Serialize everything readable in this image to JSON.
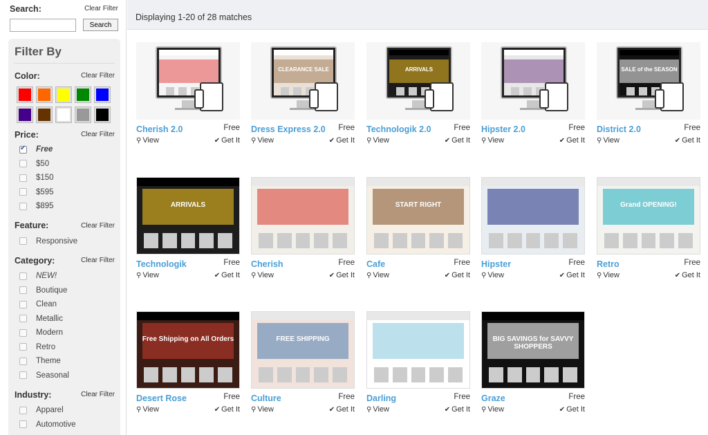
{
  "search": {
    "label": "Search:",
    "clear": "Clear Filter",
    "value": "",
    "placeholder": "",
    "button": "Search"
  },
  "filter": {
    "title": "Filter By",
    "color": {
      "label": "Color:",
      "clear": "Clear Filter",
      "swatches": [
        "#ff0000",
        "#ff6600",
        "#ffff00",
        "#008800",
        "#0000ff",
        "#440088",
        "#663300",
        "#ffffff",
        "#999999",
        "#000000"
      ]
    },
    "price": {
      "label": "Price:",
      "clear": "Clear Filter",
      "options": [
        {
          "label": "Free",
          "checked": true
        },
        {
          "label": "$50",
          "checked": false
        },
        {
          "label": "$150",
          "checked": false
        },
        {
          "label": "$595",
          "checked": false
        },
        {
          "label": "$895",
          "checked": false
        }
      ]
    },
    "feature": {
      "label": "Feature:",
      "clear": "Clear Filter",
      "options": [
        {
          "label": "Responsive"
        }
      ]
    },
    "category": {
      "label": "Category:",
      "clear": "Clear Filter",
      "options": [
        {
          "label": "NEW!"
        },
        {
          "label": "Boutique"
        },
        {
          "label": "Clean"
        },
        {
          "label": "Metallic"
        },
        {
          "label": "Modern"
        },
        {
          "label": "Retro"
        },
        {
          "label": "Theme"
        },
        {
          "label": "Seasonal"
        }
      ]
    },
    "industry": {
      "label": "Industry:",
      "clear": "Clear Filter",
      "options": [
        {
          "label": "Apparel"
        },
        {
          "label": "Automotive"
        }
      ]
    }
  },
  "results": {
    "summary": "Displaying 1-20 of 28 matches",
    "view_label": "View",
    "get_label": "Get It",
    "cards": [
      {
        "name": "Cherish 2.0",
        "price": "Free",
        "thumb": "monitor",
        "screen": "#f5f5f5",
        "accent": "#e34b4b"
      },
      {
        "name": "Dress Express 2.0",
        "price": "Free",
        "thumb": "monitor",
        "screen": "#e9e1d8",
        "accent": "#a57f5b",
        "text": "CLEARANCE SALE"
      },
      {
        "name": "Technologik 2.0",
        "price": "Free",
        "thumb": "monitor",
        "screen": "#1b1b1b",
        "accent": "#f0c020",
        "text": "ARRIVALS"
      },
      {
        "name": "Hipster 2.0",
        "price": "Free",
        "thumb": "monitor",
        "screen": "#e8e8e8",
        "accent": "#7a4b8a"
      },
      {
        "name": "District 2.0",
        "price": "Free",
        "thumb": "monitor",
        "screen": "#111111",
        "accent": "#ffffff",
        "text": "SALE of the SEASON"
      },
      {
        "name": "Technologik",
        "price": "Free",
        "thumb": "page",
        "screen": "#1d1d1d",
        "accent": "#f0c020",
        "text": "ARRIVALS"
      },
      {
        "name": "Cherish",
        "price": "Free",
        "thumb": "page",
        "screen": "#f2efe9",
        "accent": "#d9443b"
      },
      {
        "name": "Cafe",
        "price": "Free",
        "thumb": "page",
        "screen": "#f6efe5",
        "accent": "#8a5a33",
        "text": "START RIGHT"
      },
      {
        "name": "Hipster",
        "price": "Free",
        "thumb": "page",
        "screen": "#e8edf2",
        "accent": "#2f3e8c"
      },
      {
        "name": "Retro",
        "price": "Free",
        "thumb": "page",
        "screen": "#f3f3f0",
        "accent": "#2fb4c2",
        "text": "Grand OPENING!"
      },
      {
        "name": "Desert Rose",
        "price": "Free",
        "thumb": "page",
        "screen": "#3a1c14",
        "accent": "#c0392b",
        "text": "Free Shipping on All Orders"
      },
      {
        "name": "Culture",
        "price": "Free",
        "thumb": "page",
        "screen": "#f1e2dc",
        "accent": "#5d87b5",
        "text": "FREE SHIPPING"
      },
      {
        "name": "Darling",
        "price": "Free",
        "thumb": "page",
        "screen": "#ffffff",
        "accent": "#8fcbe0"
      },
      {
        "name": "Graze",
        "price": "Free",
        "thumb": "page",
        "screen": "#111111",
        "accent": "#ffffff",
        "text": "BIG SAVINGS for SAVVY SHOPPERS"
      }
    ]
  }
}
